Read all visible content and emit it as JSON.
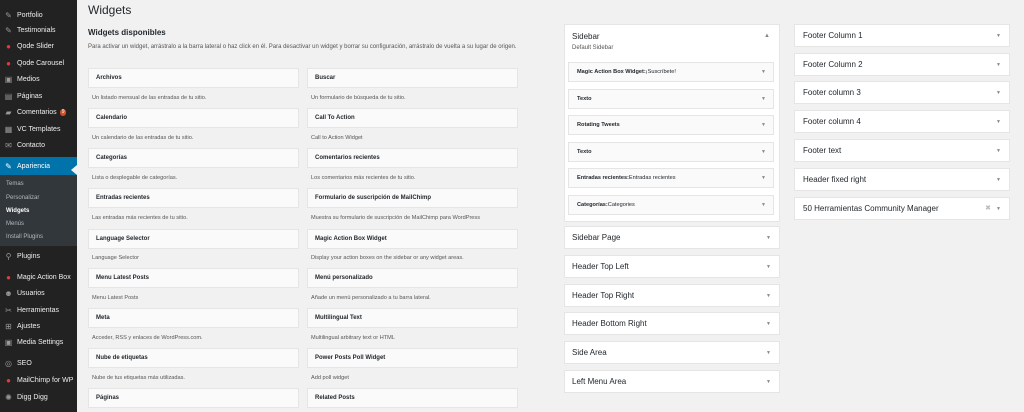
{
  "menu": {
    "items": [
      {
        "label": "Portfolio",
        "icon": "pin-icon"
      },
      {
        "label": "Testimonials",
        "icon": "pin-icon"
      },
      {
        "label": "Qode Slider",
        "icon": "qode-icon"
      },
      {
        "label": "Qode Carousel",
        "icon": "qode-icon"
      },
      {
        "label": "Medios",
        "icon": "media-icon"
      },
      {
        "label": "Páginas",
        "icon": "pages-icon"
      },
      {
        "label": "Comentarios",
        "icon": "comments-icon",
        "badge": "9"
      },
      {
        "label": "VC Templates",
        "icon": "templates-icon"
      },
      {
        "label": "Contacto",
        "icon": "mail-icon"
      },
      {
        "label": "Apariencia",
        "icon": "brush-icon"
      },
      {
        "label": "Plugins",
        "icon": "plugin-icon"
      },
      {
        "label": "Magic Action Box",
        "icon": "magic-icon"
      },
      {
        "label": "Usuarios",
        "icon": "users-icon"
      },
      {
        "label": "Herramientas",
        "icon": "tools-icon"
      },
      {
        "label": "Ajustes",
        "icon": "settings-icon"
      },
      {
        "label": "Media Settings",
        "icon": "media-settings-icon"
      },
      {
        "label": "SEO",
        "icon": "seo-icon"
      },
      {
        "label": "MailChimp for WP",
        "icon": "mailchimp-icon"
      },
      {
        "label": "Digg Digg",
        "icon": "gear-icon"
      }
    ],
    "submenu": [
      "Temas",
      "Personalizar",
      "Widgets",
      "Menús",
      "Install Plugins"
    ]
  },
  "page": {
    "title": "Widgets",
    "available_heading": "Widgets disponibles",
    "available_desc": "Para activar un widget, arrástralo a la barra lateral o haz click en él. Para desactivar un widget y borrar su configuración, arrástralo de vuelta a su lugar de origen."
  },
  "widgets_left": [
    {
      "name": "Archivos",
      "desc": "Un listado mensual de las entradas de tu sitio."
    },
    {
      "name": "Calendario",
      "desc": "Un calendario de las entradas de tu sitio."
    },
    {
      "name": "Categorías",
      "desc": "Lista o desplegable de categorías."
    },
    {
      "name": "Entradas recientes",
      "desc": "Las entradas más recientes de tu sitio."
    },
    {
      "name": "Language Selector",
      "desc": "Language Selector"
    },
    {
      "name": "Menu Latest Posts",
      "desc": "Menu Latest Posts"
    },
    {
      "name": "Meta",
      "desc": "Acceder, RSS y enlaces de WordPress.com."
    },
    {
      "name": "Nube de etiquetas",
      "desc": "Nube de tus etiquetas más utilizadas."
    },
    {
      "name": "Páginas",
      "desc": ""
    }
  ],
  "widgets_right": [
    {
      "name": "Buscar",
      "desc": "Un formulario de búsqueda de tu sitio."
    },
    {
      "name": "Call To Action",
      "desc": "Call to Action Widget"
    },
    {
      "name": "Comentarios recientes",
      "desc": "Los comentarios más recientes de tu sitio."
    },
    {
      "name": "Formulario de suscripción de MailChimp",
      "desc": "Muestra su formulario de suscripción de MailChimp para WordPress"
    },
    {
      "name": "Magic Action Box Widget",
      "desc": "Display your action boxes on the sidebar or any widget areas."
    },
    {
      "name": "Menú personalizado",
      "desc": "Añade un menú personalizado a tu barra lateral."
    },
    {
      "name": "Multilingual Text",
      "desc": "Multilingual arbitrary text or HTML"
    },
    {
      "name": "Power Posts Poll Widget",
      "desc": "Add poll widget"
    },
    {
      "name": "Related Posts",
      "desc": ""
    }
  ],
  "sidebar_area": {
    "title": "Sidebar",
    "desc": "Default Sidebar",
    "widgets": [
      {
        "name": "Magic Action Box Widget:",
        "sub": " ¡Suscríbete!"
      },
      {
        "name": "Texto",
        "sub": ""
      },
      {
        "name": "Rotating Tweets",
        "sub": ""
      },
      {
        "name": "Texto",
        "sub": ""
      },
      {
        "name": "Entradas recientes:",
        "sub": " Entradas recientes"
      },
      {
        "name": "Categorías:",
        "sub": " Categories"
      }
    ]
  },
  "middle_areas": [
    "Sidebar Page",
    "Header Top Left",
    "Header Top Right",
    "Header Bottom Right",
    "Side Area",
    "Left Menu Area"
  ],
  "right_areas": [
    "Footer Column 1",
    "Footer Column 2",
    "Footer column 3",
    "Footer column 4",
    "Footer text",
    "Header fixed right",
    "50 Herramientas Community Manager"
  ]
}
